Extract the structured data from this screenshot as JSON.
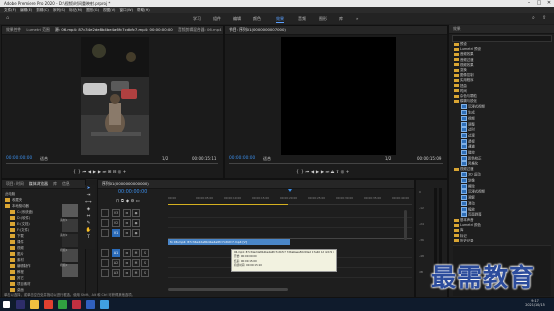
{
  "window": {
    "title": "Adobe Premiere Pro 2020 - D:\\视频\\时间重映射.prproj *",
    "controls": [
      "–",
      "□",
      "✕"
    ]
  },
  "menu": [
    "文件(F)",
    "编辑(E)",
    "剪辑(C)",
    "序列(S)",
    "标记(M)",
    "图形(G)",
    "视图(V)",
    "窗口(W)",
    "帮助(H)"
  ],
  "workspaces": {
    "items": [
      "学习",
      "组件",
      "编辑",
      "颜色",
      "效果",
      "音频",
      "图形",
      "库"
    ],
    "active": "效果",
    "overflow": "»"
  },
  "source": {
    "tabs": [
      "效果控件",
      "Lumetri 范围",
      "源: 06.mp4: 87c34e2de8b4be4a6fc7cdbfc7.mp4: 00:00:00:00",
      "音频剪辑混合器: 06.mp4"
    ],
    "timecode_in": "00:00:00:00",
    "fit": "适合",
    "scale": "1/2",
    "timecode_out": "00:00:15:11"
  },
  "program": {
    "tabs": [
      "节目: 序列01(0000000007000)"
    ],
    "timecode_in": "00:00:00:00",
    "fit": "适合",
    "scale": "1/2",
    "timecode_out": "00:00:15:09"
  },
  "project": {
    "tabs": [
      "项目: 时间",
      "媒体浏览器",
      "库",
      "信息"
    ],
    "breadcrumb": "此电脑",
    "tree": [
      "收藏夹",
      "本地驱动器",
      "C:(系统盘)",
      "D:(软件)",
      "E:(文档)",
      "F:(文件)",
      "下载",
      "课件",
      "视频",
      "图片",
      "素材",
      "编辑制作",
      "教程",
      "其它",
      "项目素材",
      "桌面"
    ],
    "thumbs": [
      "素材1",
      "素材2",
      "视频1",
      "视频2"
    ]
  },
  "effects": {
    "header": "效果",
    "items": [
      {
        "t": "f",
        "l": "预设"
      },
      {
        "t": "f",
        "l": "Lumetri 预设"
      },
      {
        "t": "f",
        "l": "音频效果"
      },
      {
        "t": "f",
        "l": "音频过渡"
      },
      {
        "t": "f",
        "l": "视频效果"
      },
      {
        "t": "f",
        "l": "变换"
      },
      {
        "t": "f",
        "l": "图像控制"
      },
      {
        "t": "f",
        "l": "实用程序"
      },
      {
        "t": "f",
        "l": "扭曲"
      },
      {
        "t": "f",
        "l": "时间"
      },
      {
        "t": "f",
        "l": "杂色与颗粒"
      },
      {
        "t": "f",
        "l": "模糊与锐化"
      },
      {
        "t": "x",
        "l": "沉浸式视频"
      },
      {
        "t": "x",
        "l": "生成"
      },
      {
        "t": "x",
        "l": "视频"
      },
      {
        "t": "x",
        "l": "调整"
      },
      {
        "t": "x",
        "l": "过时"
      },
      {
        "t": "x",
        "l": "过渡"
      },
      {
        "t": "x",
        "l": "透视"
      },
      {
        "t": "x",
        "l": "通道"
      },
      {
        "t": "x",
        "l": "键控"
      },
      {
        "t": "x",
        "l": "颜色校正"
      },
      {
        "t": "x",
        "l": "风格化"
      },
      {
        "t": "f",
        "l": "视频过渡"
      },
      {
        "t": "x",
        "l": "3D 运动"
      },
      {
        "t": "x",
        "l": "划像"
      },
      {
        "t": "x",
        "l": "擦除"
      },
      {
        "t": "x",
        "l": "沉浸式视频"
      },
      {
        "t": "x",
        "l": "溶解"
      },
      {
        "t": "x",
        "l": "滑动"
      },
      {
        "t": "x",
        "l": "缩放"
      },
      {
        "t": "x",
        "l": "页面剥落"
      },
      {
        "t": "f",
        "l": "基本声音"
      },
      {
        "t": "f",
        "l": "Lumetri 颜色"
      },
      {
        "t": "f",
        "l": "库"
      },
      {
        "t": "f",
        "l": "标记"
      },
      {
        "t": "f",
        "l": "历史记录"
      }
    ]
  },
  "timeline": {
    "tab": "序列01(0000000000000)",
    "timecode": "00:00:00:00",
    "ruler": [
      "00:00",
      "00:00:05:00",
      "00:00:10:00",
      "00:00:15:00",
      "00:00:20:00",
      "00:00:25:00",
      "00:00:30:00",
      "00:00:35:00",
      "00:00:40:00"
    ],
    "tracks": [
      "V3",
      "V2",
      "V1",
      "A1",
      "A2",
      "A3"
    ],
    "clip_label": "fx 06.mp4: 87c34e2de8b4be4a6fc7cdbfc7.mp4 [V]",
    "tooltip": [
      "06.mp4: 87c34e2de8b4be4a6fc7cdbfc7 7d6a6aea50c09e2 17a40 1d 4c1f1 mp4",
      "开始: 00:00:00:00",
      "结束: 00:00:15:09",
      "持续时间: 00:00:15:10"
    ],
    "meter_labels": [
      "0",
      "-12",
      "-24",
      "-36",
      "-48",
      "dB"
    ]
  },
  "status": "单击以选择，或单击空白处并拖动以进行框选。使用 Shift、Alt 和 Ctrl 可获得其他选项。",
  "watermark": "最需教育",
  "taskbar": {
    "time": "9:17",
    "date": "2021/10/15"
  },
  "colors": {
    "accent": "#3b8eea",
    "clip": "#4a86c8",
    "watermark": "#2c4c9c"
  }
}
